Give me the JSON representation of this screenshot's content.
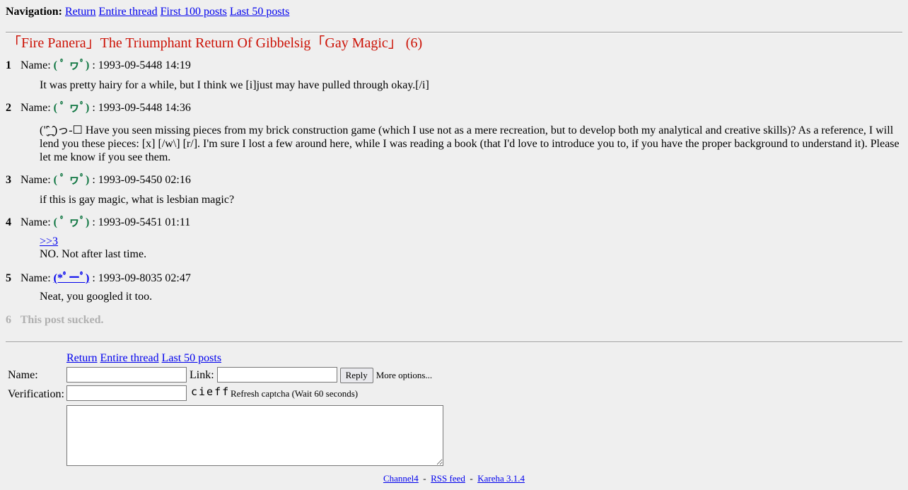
{
  "nav": {
    "label": "Navigation:",
    "links": [
      "Return",
      "Entire thread",
      "First 100 posts",
      "Last 50 posts"
    ]
  },
  "thread": {
    "title": "「Fire Panera」The Triumphant Return Of Gibbelsig「Gay Magic」 (6)"
  },
  "posts": [
    {
      "num": "1",
      "name_label": "Name:",
      "name": "( ﾟ ヮﾟ)",
      "date": ": 1993-09-5448 14:19",
      "body": [
        "It was pretty hairy for a while, but I think we [i]just may have pulled through okay.[/i]"
      ]
    },
    {
      "num": "2",
      "name_label": "Name:",
      "name": "( ﾟ ヮﾟ)",
      "date": ": 1993-09-5448 14:36",
      "body": [
        "(\"̮̂_̮̂)っ-☐ Have you seen missing pieces from my brick construction game (which I use not as a mere recreation, but to develop both my analytical and creative skills)? As a reference, I will lend you these pieces: [x] [/w\\] [r/]. I'm sure I lost a few around here, while I was reading a book (that I'd love to introduce you to, if you have the proper background to understand it). Please let me know if you see them."
      ]
    },
    {
      "num": "3",
      "name_label": "Name:",
      "name": "( ﾟ ヮﾟ)",
      "date": ": 1993-09-5450 02:16",
      "body": [
        "if this is gay magic, what is lesbian magic?"
      ]
    },
    {
      "num": "4",
      "name_label": "Name:",
      "name": "( ﾟ ヮﾟ)",
      "date": ": 1993-09-5451 01:11",
      "reply_link": ">>3",
      "body": [
        "NO. Not after last time."
      ]
    },
    {
      "num": "5",
      "name_label": "Name:",
      "name": "(*ﾟーﾟ)",
      "date": ": 1993-09-8035 02:47",
      "body": [
        "Neat, you googled it too."
      ]
    },
    {
      "num": "6",
      "deleted_text": "This post sucked."
    }
  ],
  "form": {
    "links": [
      "Return",
      "Entire thread",
      "Last 50 posts"
    ],
    "name_label": "Name:",
    "link_label": "Link:",
    "reply_button": "Reply",
    "more_options": "More options...",
    "verification_label": "Verification:",
    "captcha_text": "cieff",
    "refresh_captcha": "Refresh captcha",
    "wait_note": "(Wait 60 seconds)"
  },
  "footer": {
    "links": [
      "Channel4",
      "RSS feed",
      "Kareha 3.1.4"
    ],
    "separator": "-"
  },
  "colors": {
    "background": "#efefef",
    "title": "#cc1105",
    "name": "#117743",
    "link": "#0000ee",
    "deleted": "#b0b0b0"
  }
}
